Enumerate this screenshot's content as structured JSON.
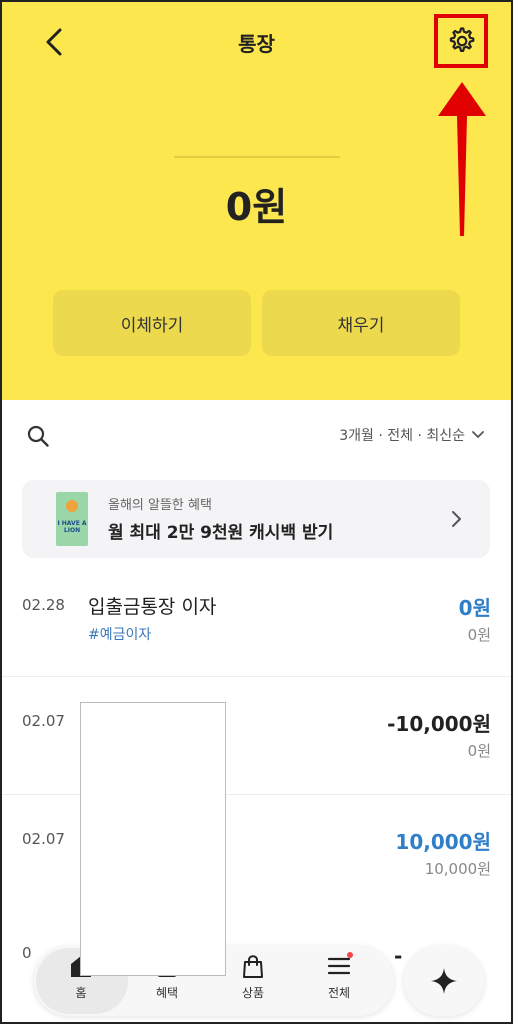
{
  "header": {
    "title": "통장"
  },
  "account": {
    "balance": "0원"
  },
  "actions": {
    "transfer_label": "이체하기",
    "fill_label": "채우기"
  },
  "filter": {
    "label": "3개월 · 전체 · 최신순"
  },
  "promo": {
    "subtitle": "올해의 알뜰한 혜택",
    "title": "월 최대 2만 9천원 캐시백 받기",
    "image_text": "I HAVE A LION"
  },
  "transactions": [
    {
      "date": "02.28",
      "name": "입출금통장 이자",
      "tag": "#예금이자",
      "amount": "0원",
      "balance": "0원",
      "amount_color": "#2f7ec8"
    },
    {
      "date": "02.07",
      "name": "",
      "tag": "",
      "amount": "-10,000원",
      "balance": "0원",
      "amount_color": "#222222"
    },
    {
      "date": "02.07",
      "name": "",
      "tag": "",
      "amount": "10,000원",
      "balance": "10,000원",
      "amount_color": "#2f7ec8"
    }
  ],
  "peek": {
    "date": "0",
    "amount": "-"
  },
  "nav": {
    "home": "홈",
    "benefits": "혜택",
    "products": "상품",
    "all": "전체"
  },
  "colors": {
    "header_bg": "#fce74e",
    "accent_blue": "#2f7ec8",
    "annotation_red": "#e00000"
  }
}
